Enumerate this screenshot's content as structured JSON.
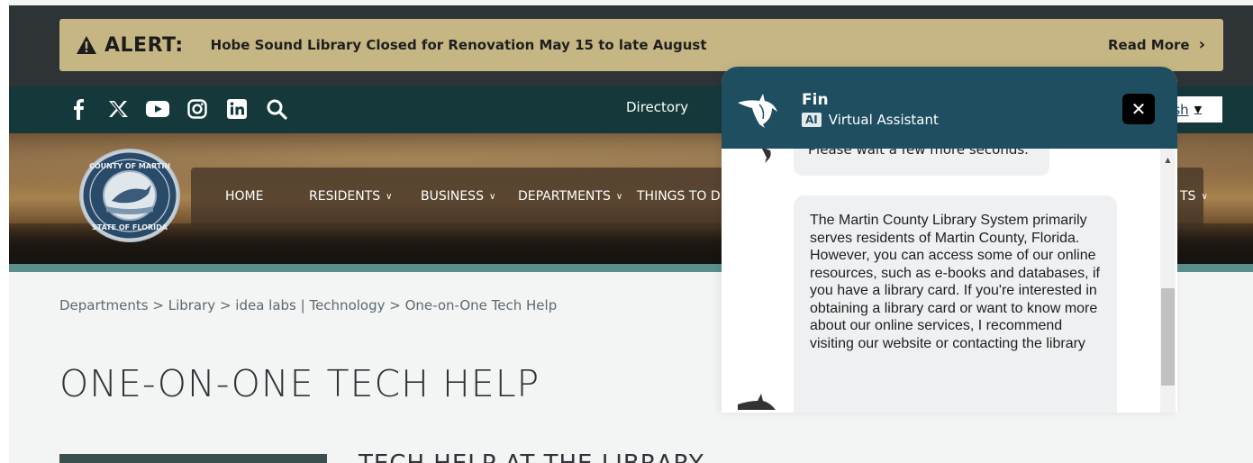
{
  "alert": {
    "label": "ALERT:",
    "message": "Hobe Sound Library Closed for Renovation May 15 to late August",
    "read_more": "Read More"
  },
  "utility": {
    "social_icons": [
      "facebook-icon",
      "x-icon",
      "youtube-icon",
      "instagram-icon",
      "linkedin-icon",
      "search-icon"
    ],
    "directory": "Directory",
    "language_partial": "lish"
  },
  "nav": {
    "items": [
      "HOME",
      "RESIDENTS",
      "BUSINESS",
      "DEPARTMENTS",
      "THINGS TO D"
    ],
    "right_partial": "TS"
  },
  "breadcrumb": {
    "items": [
      "Departments",
      "Library",
      "idea labs | Technology",
      "One-on-One Tech Help"
    ],
    "separator": ">"
  },
  "page": {
    "title": "ONE-ON-ONE TECH HELP",
    "subhead_partial": "TECH HELP AT THE LIBRARY"
  },
  "chat": {
    "name": "Fin",
    "ai_badge": "AI",
    "role": "Virtual Assistant",
    "previous_message_partial": "Please wait a few more seconds.",
    "message": "The Martin County Library System primarily serves residents of Martin County, Florida. However, you can access some of our online resources, such as e-books and databases, if you have a library card. If you're interested in obtaining a library card or want to know more about our online services, I recommend visiting our website or contacting the library"
  },
  "colors": {
    "alert_bg": "#c6b683",
    "util_bar": "#15393b",
    "chat_header": "#1e4e5f",
    "teal_line": "#5b8f8e"
  }
}
